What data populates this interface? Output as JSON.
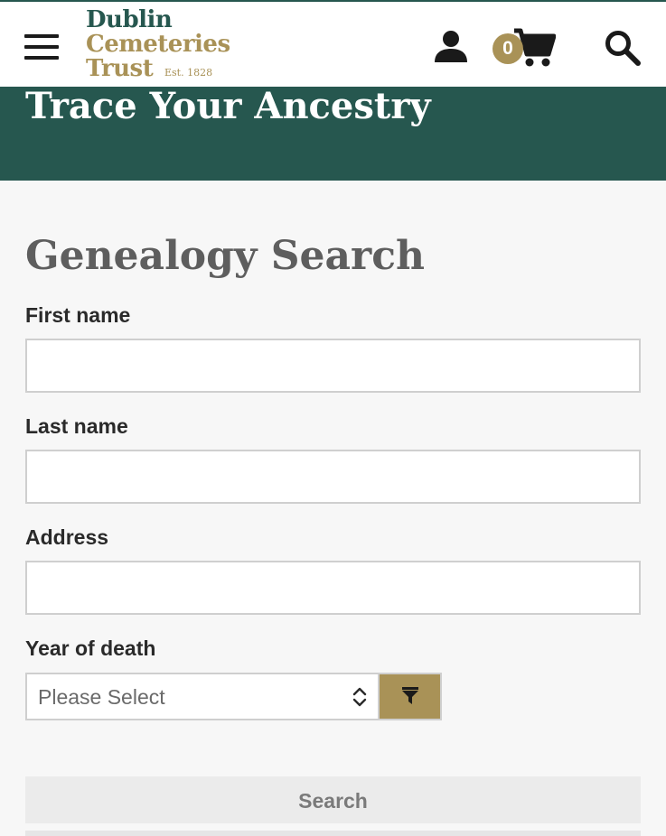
{
  "header": {
    "logo": {
      "line1": "Dublin",
      "line2": "Cemeteries",
      "line3": "Trust",
      "established": "Est. 1828"
    },
    "cart_count": "0",
    "icons": {
      "menu": "hamburger-menu-icon",
      "account": "user-icon",
      "cart": "shopping-cart-icon",
      "search": "search-icon"
    }
  },
  "banner": {
    "title": "Trace Your Ancestry"
  },
  "form": {
    "title": "Genealogy Search",
    "first_name_label": "First name",
    "first_name_value": "",
    "last_name_label": "Last name",
    "last_name_value": "",
    "address_label": "Address",
    "address_value": "",
    "year_label": "Year of death",
    "year_selected": "Please Select",
    "submit_label": "Search"
  },
  "colors": {
    "brand_green": "#26574f",
    "brand_gold": "#a99257",
    "background": "#f7f7f7"
  }
}
